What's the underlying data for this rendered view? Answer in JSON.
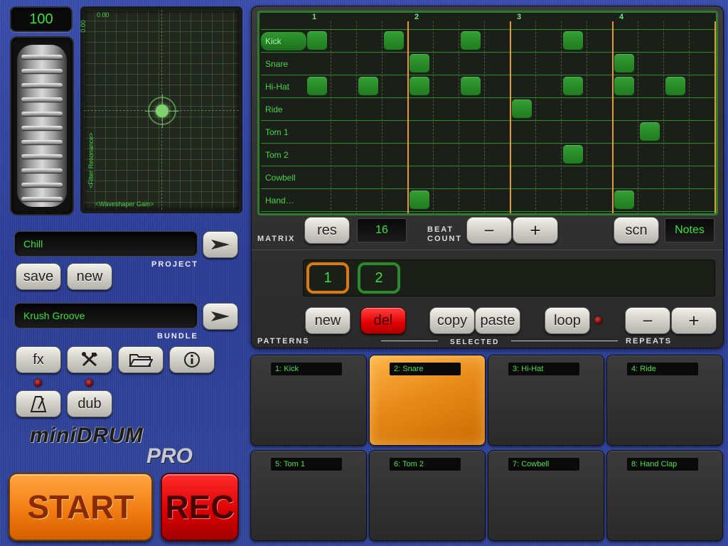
{
  "tempo": {
    "value": "100"
  },
  "xy_pad": {
    "x_value": "0.00",
    "y_value": "0.00",
    "x_label": "<Waveshaper Gain>",
    "y_label": "<Filter Resonance>"
  },
  "project": {
    "name": "Chill",
    "caption": "PROJECT",
    "save_label": "save",
    "new_label": "new"
  },
  "bundle": {
    "name": "Krush Groove",
    "caption": "BUNDLE"
  },
  "tools": {
    "fx_label": "fx",
    "dub_label": "dub"
  },
  "logo": {
    "line1": "miniDRUM",
    "line2": "PRO"
  },
  "transport": {
    "start_label": "START",
    "rec_label": "REC"
  },
  "matrix": {
    "bars": [
      "1",
      "2",
      "3",
      "4"
    ],
    "rows": [
      "Kick",
      "Snare",
      "Hi-Hat",
      "Ride",
      "Tom 1",
      "Tom 2",
      "Cowbell",
      "Hand…"
    ],
    "selected_row": 0,
    "steps": 16,
    "active_cells": {
      "Kick": [
        0,
        3,
        6,
        10
      ],
      "Snare": [
        4,
        12
      ],
      "Hi-Hat": [
        0,
        2,
        4,
        6,
        10,
        12,
        14
      ],
      "Ride": [
        8
      ],
      "Tom 1": [
        13
      ],
      "Tom 2": [
        10
      ],
      "Cowbell": [],
      "Hand…": [
        4,
        12
      ]
    },
    "caption": "MATRIX",
    "res_label": "res",
    "res_value": "16",
    "beat_count_caption_1": "BEAT",
    "beat_count_caption_2": "COUNT",
    "minus_label": "−",
    "plus_label": "+",
    "scn_label": "scn",
    "notes_label": "Notes"
  },
  "patterns": {
    "items": [
      "1",
      "2"
    ],
    "caption": "PATTERNS",
    "new_label": "new",
    "del_label": "del",
    "copy_label": "copy",
    "paste_label": "paste",
    "loop_label": "loop",
    "selected_caption": "SELECTED",
    "repeats_caption": "REPEATS",
    "minus_label": "−",
    "plus_label": "+"
  },
  "pads": [
    {
      "label": "1: Kick",
      "active": false
    },
    {
      "label": "2: Snare",
      "active": true
    },
    {
      "label": "3: Hi-Hat",
      "active": false
    },
    {
      "label": "4: Ride",
      "active": false
    },
    {
      "label": "5: Tom 1",
      "active": false
    },
    {
      "label": "6: Tom 2",
      "active": false
    },
    {
      "label": "7: Cowbell",
      "active": false
    },
    {
      "label": "8: Hand Clap",
      "active": false
    }
  ]
}
